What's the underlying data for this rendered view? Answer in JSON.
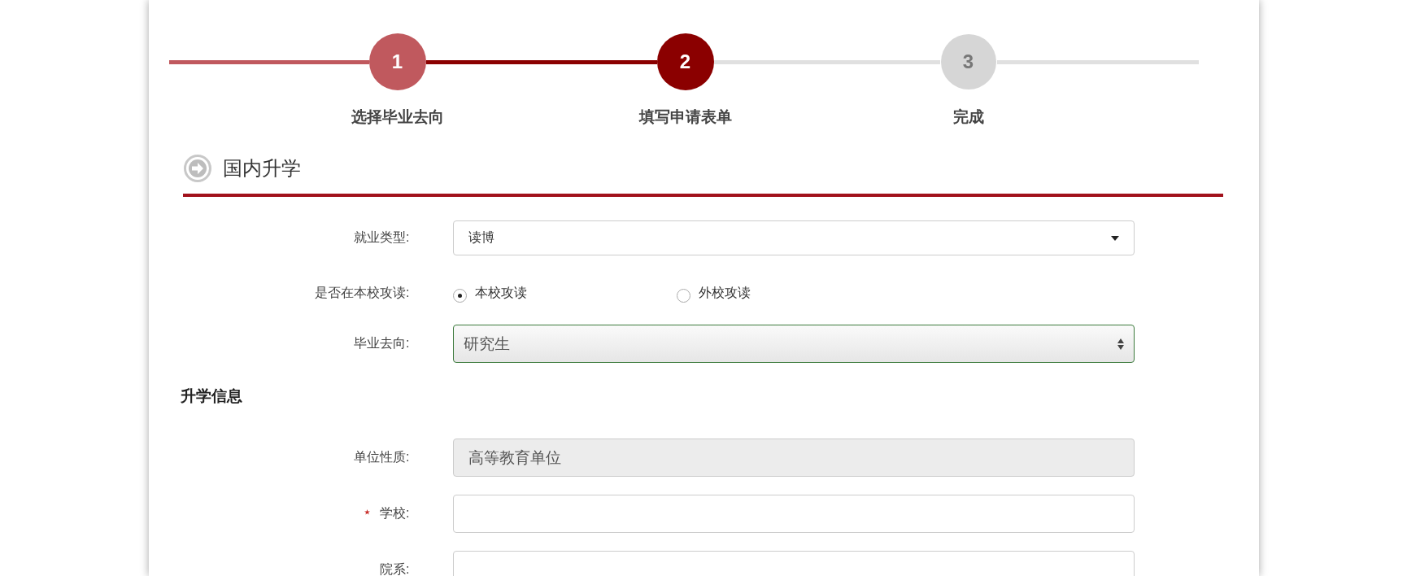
{
  "steps": [
    {
      "number": "1",
      "label": "选择毕业去向",
      "completed": true,
      "current": false
    },
    {
      "number": "2",
      "label": "填写申请表单",
      "completed": false,
      "current": true
    },
    {
      "number": "3",
      "label": "完成",
      "completed": false,
      "current": false
    }
  ],
  "section": {
    "title": "国内升学"
  },
  "rows": [
    {
      "kind": "select",
      "label": "就业类型:",
      "value": "读博",
      "required": false
    },
    {
      "kind": "radio",
      "label": "是否在本校攻读:",
      "required": false,
      "options": [
        {
          "label": "本校攻读",
          "selected": true
        },
        {
          "label": "外校攻读",
          "selected": false
        }
      ]
    },
    {
      "kind": "native-select",
      "label": "毕业去向:",
      "value": "研究生",
      "required": false
    },
    {
      "kind": "heading",
      "label": "升学信息"
    },
    {
      "kind": "readonly",
      "label": "单位性质:",
      "value": "高等教育单位",
      "required": false
    },
    {
      "kind": "text",
      "label": "学校:",
      "value": "",
      "required": true
    },
    {
      "kind": "text",
      "label": "院系:",
      "value": "",
      "required": false
    }
  ]
}
